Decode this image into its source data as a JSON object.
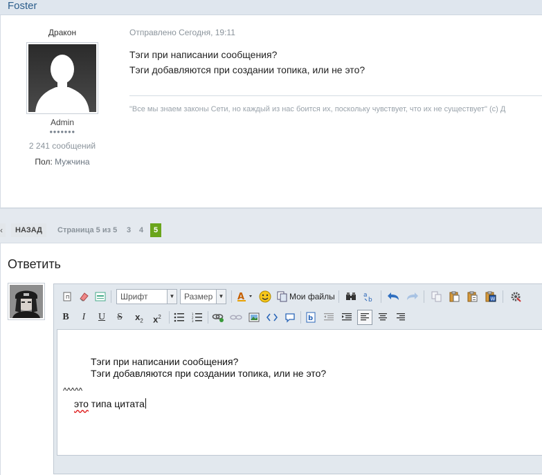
{
  "thread": {
    "author_header": "Foster"
  },
  "post": {
    "user": {
      "name": "Дракон",
      "group": "Admin",
      "rank_pips": "●●●●●●●",
      "posts_count": "2 241 сообщений",
      "sex_label": "Пол:",
      "sex_value": "Мужчина"
    },
    "date": "Отправлено Сегодня, 19:11",
    "body_lines": [
      "Тэги при написании сообщения?",
      "Тэги добавляются при создании топика, или не это?"
    ],
    "signature": "\"Все мы знаем законы Сети, но каждый из нас боится их, поскольку чувствует, что их не существует\" (с) Д"
  },
  "pagination": {
    "prev_arrow": "‹",
    "back_label": "НАЗАД",
    "page_info": "Страница 5 из 5",
    "pages": [
      "3",
      "4"
    ],
    "current_page": "5"
  },
  "reply": {
    "title": "Ответить",
    "toolbar": {
      "font_select": "Шрифт",
      "size_select": "Размер",
      "my_files_label": "Мои файлы",
      "bold_label": "B",
      "italic_label": "I",
      "underline_label": "U",
      "strike_label": "S",
      "subscript_label": "x",
      "superscript_label": "x",
      "subscript_mark": "2",
      "superscript_mark": "2"
    },
    "editor_content": {
      "quote_line_1": "Тэги при написании сообщения?",
      "quote_line_2": "Тэги добавляются при создании топика, или не это?",
      "carets": "^^^^^",
      "typed_word_misspelled": "это",
      "typed_rest": " типа цитата"
    }
  }
}
